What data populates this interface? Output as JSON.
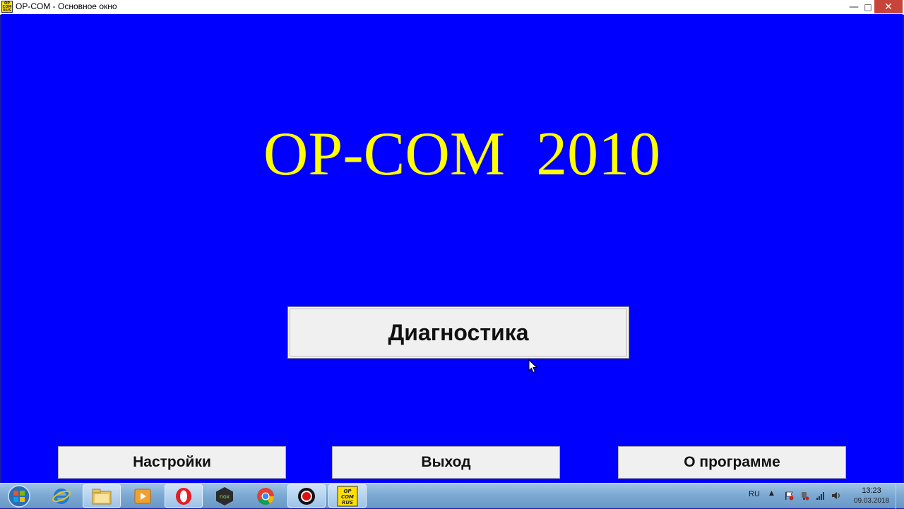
{
  "window": {
    "icon_text": "OP COM RUS",
    "title": "OP-COM - Основное окно",
    "minimize_glyph": "—",
    "maximize_glyph": "□",
    "close_glyph": "✕"
  },
  "main": {
    "title": "OP-COM  2010",
    "diagnostics_label": "Диагностика",
    "settings_label": "Настройки",
    "exit_label": "Выход",
    "about_label": "О программе"
  },
  "taskbar": {
    "apps": [
      {
        "name": "internet-explorer-icon"
      },
      {
        "name": "file-explorer-icon"
      },
      {
        "name": "media-player-icon"
      },
      {
        "name": "opera-icon"
      },
      {
        "name": "nox-icon",
        "label": "nox"
      },
      {
        "name": "chrome-icon"
      },
      {
        "name": "record-icon"
      },
      {
        "name": "opcom-icon",
        "label": "OP COM RUS"
      }
    ],
    "language": "RU",
    "tray_expand_glyph": "▲",
    "time": "13:23",
    "date": "09.03.2018"
  },
  "colors": {
    "client_background": "#0000ff",
    "title_text": "#ffff00",
    "button_face": "#f0f0f0",
    "close_button": "#c7443a"
  }
}
